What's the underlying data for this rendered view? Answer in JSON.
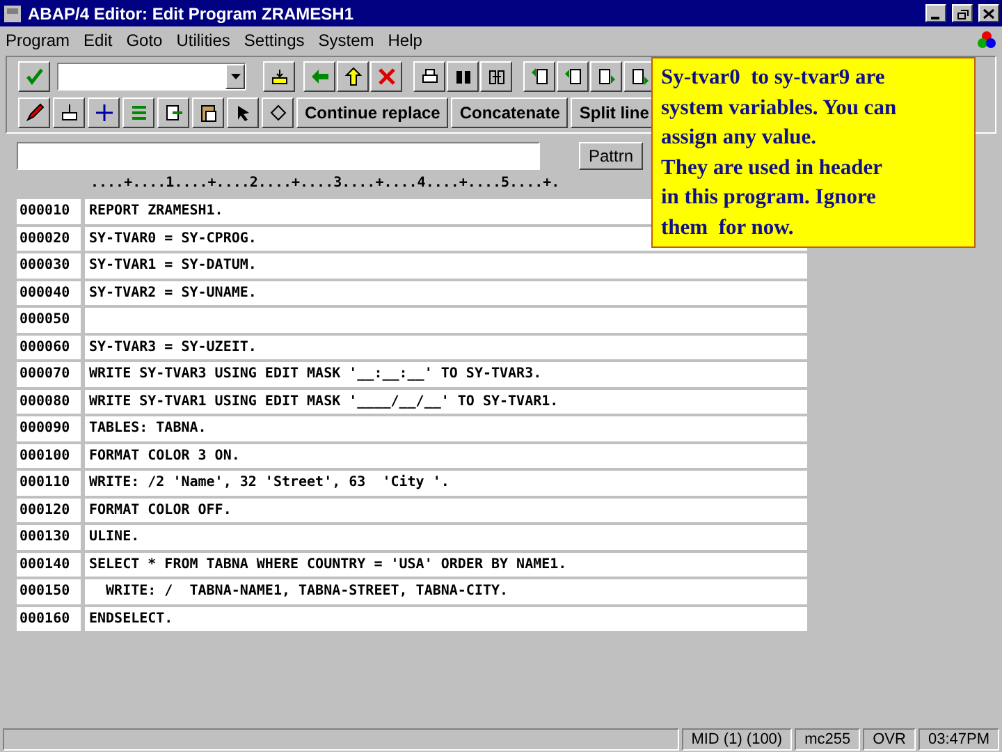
{
  "window": {
    "title": "ABAP/4 Editor: Edit Program ZRAMESH1"
  },
  "menu": [
    "Program",
    "Edit",
    "Goto",
    "Utilities",
    "Settings",
    "System",
    "Help"
  ],
  "toolbar_buttons": [
    "Continue replace",
    "Concatenate",
    "Split line"
  ],
  "pattern_button": "Pattrn",
  "ruler": "....+....1....+....2....+....3....+....4....+....5....+.",
  "lines": [
    {
      "number": "000010",
      "code": "REPORT ZRAMESH1."
    },
    {
      "number": "000020",
      "code": "SY-TVAR0 = SY-CPROG."
    },
    {
      "number": "000030",
      "code": "SY-TVAR1 = SY-DATUM."
    },
    {
      "number": "000040",
      "code": "SY-TVAR2 = SY-UNAME."
    },
    {
      "number": "000050"
    },
    {
      "number": "000060",
      "code": "SY-TVAR3 = SY-UZEIT."
    },
    {
      "number": "000070",
      "code": "WRITE SY-TVAR3 USING EDIT MASK '__:__:__' TO SY-TVAR3."
    },
    {
      "number": "000080",
      "code": "WRITE SY-TVAR1 USING EDIT MASK '____/__/__' TO SY-TVAR1."
    },
    {
      "number": "000090",
      "code": "TABLES: TABNA."
    },
    {
      "number": "000100",
      "code": "FORMAT COLOR 3 ON."
    },
    {
      "number": "000110",
      "code": "WRITE: /2 'Name', 32 'Street', 63  'City '."
    },
    {
      "number": "000120",
      "code": "FORMAT COLOR OFF."
    },
    {
      "number": "000130",
      "code": "ULINE."
    },
    {
      "number": "000140",
      "code": "SELECT * FROM TABNA WHERE COUNTRY = 'USA' ORDER BY NAME1."
    },
    {
      "number": "000150",
      "code": "  WRITE: /  TABNA-NAME1, TABNA-STREET, TABNA-CITY."
    },
    {
      "number": "000160",
      "code": "ENDSELECT."
    }
  ],
  "callout": {
    "lines": [
      "Sy-tvar0  to sy-tvar9 are",
      "system variables. You can",
      "assign any value.",
      "They are used in header",
      "in this program. Ignore",
      "them  for now."
    ]
  },
  "status_bar": [
    "MID (1) (100)",
    "mc255",
    "OVR",
    "03:47PM"
  ]
}
